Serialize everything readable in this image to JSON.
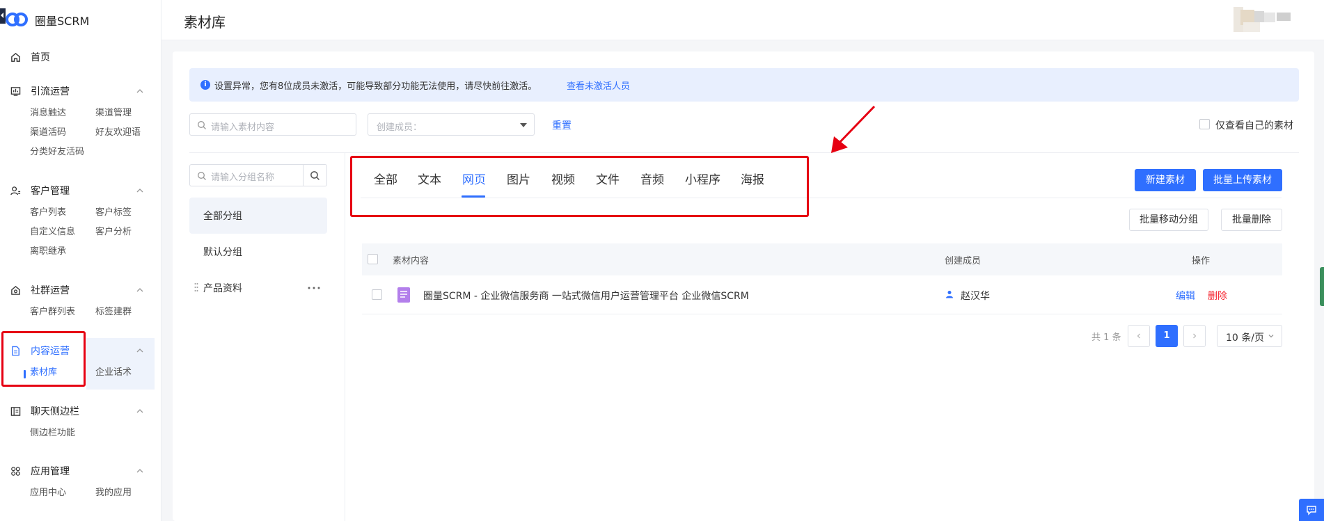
{
  "app": {
    "name": "圈量SCRM"
  },
  "header": {
    "title": "素材库"
  },
  "sidebar": {
    "home": "首页",
    "groups": [
      {
        "title": "引流运营",
        "items": [
          "消息触达",
          "渠道管理",
          "渠道活码",
          "好友欢迎语",
          "分类好友活码"
        ]
      },
      {
        "title": "客户管理",
        "items": [
          "客户列表",
          "客户标签",
          "自定义信息",
          "客户分析",
          "离职继承"
        ]
      },
      {
        "title": "社群运营",
        "items": [
          "客户群列表",
          "标签建群"
        ]
      },
      {
        "title": "内容运营",
        "items": [
          "素材库",
          "企业话术"
        ]
      },
      {
        "title": "聊天侧边栏",
        "items": [
          "侧边栏功能"
        ]
      },
      {
        "title": "应用管理",
        "items": [
          "应用中心",
          "我的应用"
        ]
      }
    ]
  },
  "notice": {
    "text": "设置异常，您有8位成员未激活，可能导致部分功能无法使用，请尽快前往激活。",
    "link": "查看未激活人员"
  },
  "filters": {
    "search_placeholder": "请输入素材内容",
    "member_placeholder": "创建成员：",
    "reset": "重置",
    "own_only": "仅查看自己的素材"
  },
  "groups_panel": {
    "search_placeholder": "请输入分组名称",
    "items": [
      "全部分组",
      "默认分组",
      "产品资料"
    ]
  },
  "tabs": [
    "全部",
    "文本",
    "网页",
    "图片",
    "视频",
    "文件",
    "音频",
    "小程序",
    "海报"
  ],
  "active_tab": "网页",
  "actions": {
    "new": "新建素材",
    "batch_upload": "批量上传素材",
    "batch_move": "批量移动分组",
    "batch_delete": "批量删除"
  },
  "table": {
    "headers": [
      "素材内容",
      "创建成员",
      "操作"
    ],
    "rows": [
      {
        "content": "圈量SCRM - 企业微信服务商 一站式微信用户运营管理平台 企业微信SCRM",
        "creator": "赵汉华",
        "edit": "编辑",
        "delete": "删除"
      }
    ]
  },
  "pagination": {
    "total": "共 1 条",
    "current": "1",
    "page_size": "10 条/页"
  },
  "colors": {
    "accent": "#2f6fff",
    "danger": "#f5222d",
    "highlight_box": "#e60012"
  }
}
